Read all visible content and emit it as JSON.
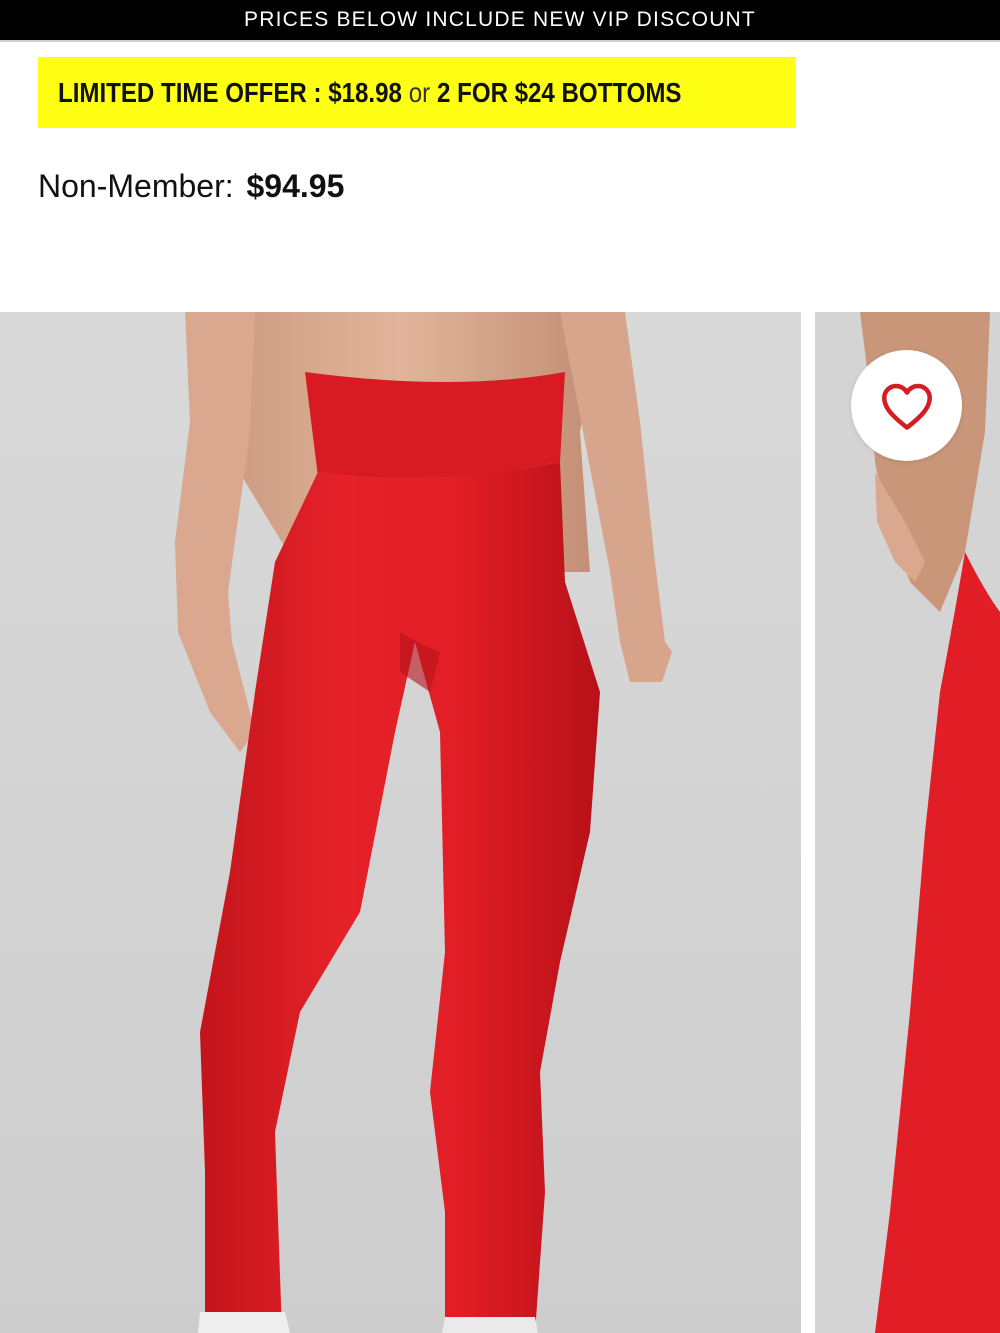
{
  "banner": {
    "text": "PRICES BELOW INCLUDE NEW VIP DISCOUNT"
  },
  "offer": {
    "prefix": "LIMITED TIME OFFER : $18.98",
    "or": "or",
    "suffix": "2 FOR $24 BOTTOMS"
  },
  "pricing": {
    "label": "Non-Member:",
    "value": "$94.95"
  },
  "gallery": {
    "images": [
      {
        "icon": "product-photo-red-leggings-front"
      },
      {
        "icon": "product-photo-red-leggings-side"
      }
    ],
    "favorite_icon": "heart-icon"
  },
  "colors": {
    "offer_bg": "#ffff14",
    "product": "#e21b22",
    "banner_bg": "#000000",
    "heart": "#d51d24"
  }
}
